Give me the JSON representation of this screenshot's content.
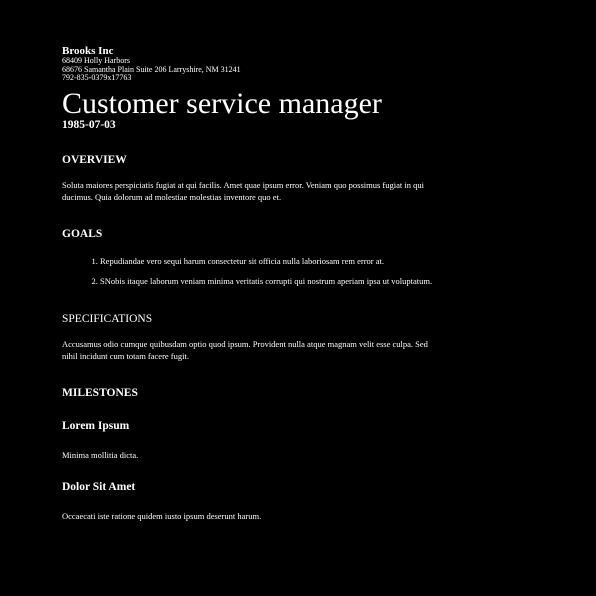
{
  "header": {
    "company": "Brooks Inc",
    "address_line1": "68409 Holly Harbors",
    "address_line2": "68676 Samantha Plain Suite 206 Larryshire, NM 31241",
    "phone": "792-835-0379x17763"
  },
  "document": {
    "title": "Customer service manager",
    "date": "1985-07-03"
  },
  "overview": {
    "heading": "OVERVIEW",
    "text": "Soluta maiores perspiciatis fugiat at qui facilis. Amet quae ipsum error. Veniam quo possimus fugiat in qui ducimus. Quia dolorum ad molestiae molestias inventore quo et."
  },
  "goals": {
    "heading": "GOALS",
    "items": [
      "Repudiandae vero sequi harum consectetur sit officia nulla laboriosam rem error at.",
      "SNobis itaque laborum veniam minima veritatis corrupti qui nostrum aperiam ipsa ut voluptatum."
    ]
  },
  "specifications": {
    "heading": "SPECIFICATIONS",
    "text": "Accusamus odio cumque quibusdam optio quod ipsum. Provident nulla atque magnam velit esse culpa. Sed nihil incidunt cum totam facere fugit."
  },
  "milestones": {
    "heading": "MILESTONES",
    "items": [
      {
        "title": "Lorem Ipsum",
        "text": "Minima mollitia dicta."
      },
      {
        "title": "Dolor Sit Amet",
        "text": "Occaecati iste ratione quidem iusto ipsum deserunt harum."
      }
    ]
  }
}
